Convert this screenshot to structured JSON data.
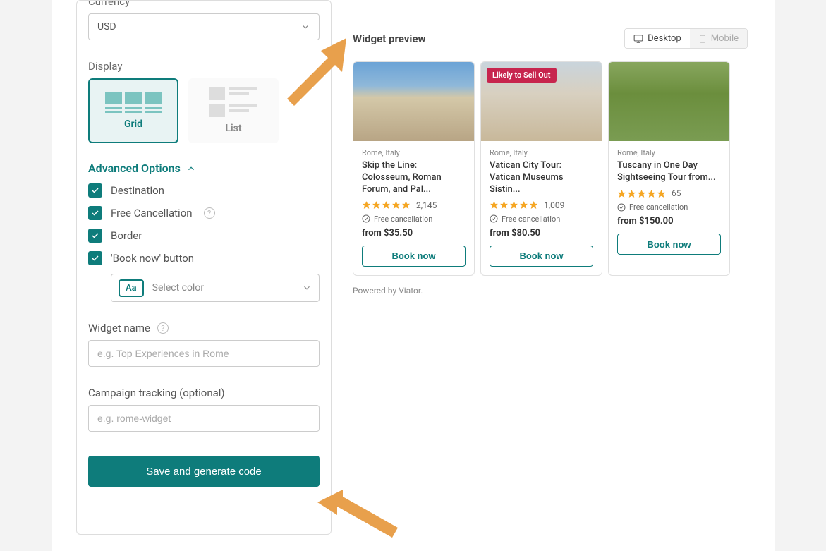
{
  "sidebar": {
    "currency_label": "Currency",
    "currency_value": "USD",
    "display_label": "Display",
    "display_options": {
      "grid": "Grid",
      "list": "List"
    },
    "advanced_title": "Advanced Options",
    "checks": {
      "destination": "Destination",
      "free_cancel": "Free Cancellation",
      "border": "Border",
      "book_now_btn": "'Book now' button"
    },
    "color_badge": "Aa",
    "color_placeholder": "Select color",
    "widget_name_label": "Widget name",
    "widget_name_placeholder": "e.g. Top Experiences in Rome",
    "campaign_label": "Campaign tracking (optional)",
    "campaign_placeholder": "e.g. rome-widget",
    "save_button": "Save and generate code"
  },
  "preview": {
    "title": "Widget preview",
    "toggle": {
      "desktop": "Desktop",
      "mobile": "Mobile"
    },
    "badge_likely": "Likely to Sell Out",
    "free_cancellation_text": "Free cancellation",
    "book_now": "Book now",
    "powered_by": "Powered by Viator.",
    "cards": [
      {
        "location": "Rome, Italy",
        "title": "Skip the Line: Colosseum, Roman Forum, and Pal...",
        "reviews": "2,145",
        "price": "from $35.50"
      },
      {
        "location": "Rome, Italy",
        "title": "Vatican City Tour: Vatican Museums Sistin...",
        "reviews": "1,009",
        "price": "from $80.50"
      },
      {
        "location": "Rome, Italy",
        "title": "Tuscany in One Day Sightseeing Tour from...",
        "reviews": "65",
        "price": "from $150.00"
      }
    ]
  },
  "colors": {
    "teal": "#0e7c7b",
    "star": "#f5a623"
  }
}
